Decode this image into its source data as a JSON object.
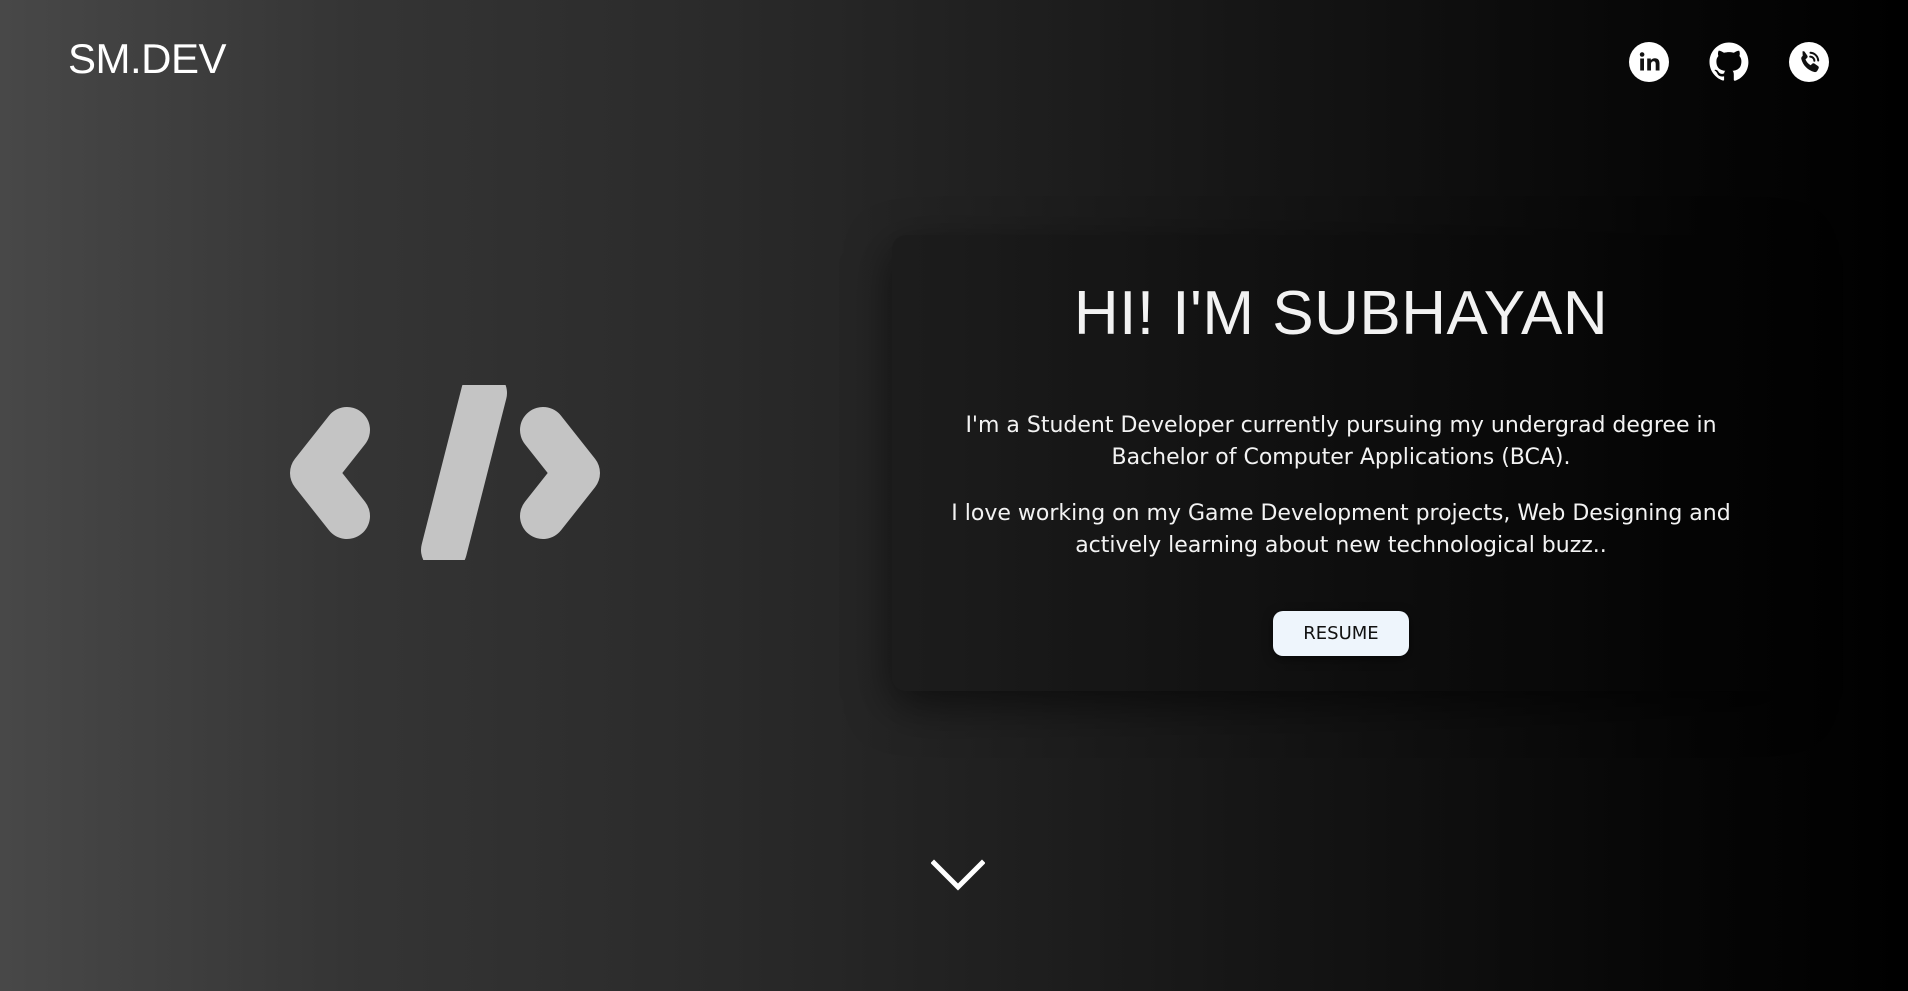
{
  "header": {
    "brand": "SM.DEV",
    "social_icons": [
      "linkedin-icon",
      "github-icon",
      "phone-icon"
    ]
  },
  "hero": {
    "icon": "code-icon",
    "title": "HI! I'M SUBHAYAN",
    "paragraph_1": "I'm a Student Developer currently pursuing my undergrad degree in Bachelor of Computer Applications (BCA).",
    "paragraph_2": "I love working on my Game Development projects, Web Designing and actively learning about new technological buzz..",
    "resume_label": "RESUME"
  },
  "scroll_hint": {
    "icon": "chevron-down-icon"
  },
  "colors": {
    "background_left": "#484848",
    "background_right": "#000000",
    "text": "#ffffff",
    "code_icon": "#c4c4c4",
    "button_bg": "#eef5fc",
    "button_text": "#111111"
  }
}
